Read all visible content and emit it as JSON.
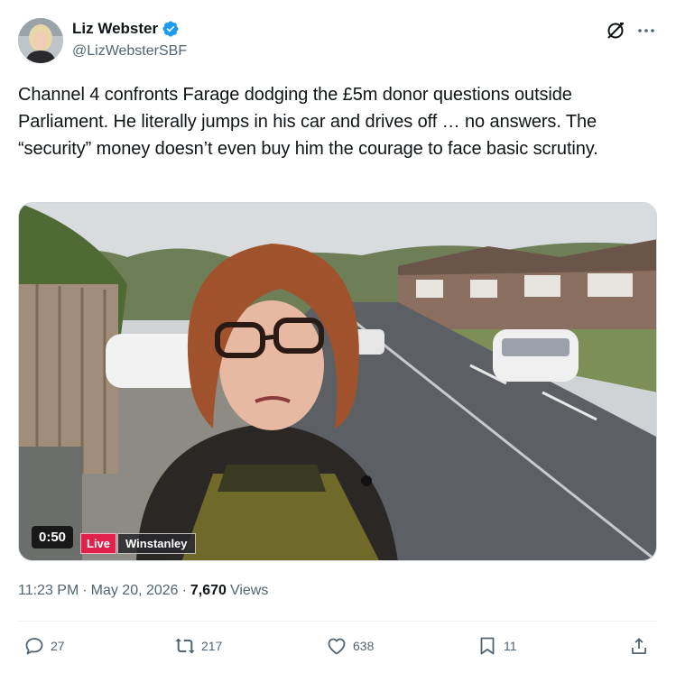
{
  "author": {
    "display_name": "Liz Webster",
    "handle": "@LizWebsterSBF",
    "verified": true
  },
  "tweet": {
    "text": "Channel 4 confronts Farage dodging the £5m donor questions outside Parliament. He literally jumps in his car and drives off … no answers. The “security” money doesn’t even buy him the courage to face basic scrutiny."
  },
  "media": {
    "duration": "0:50",
    "live_label": "Live",
    "location_label": "Winstanley"
  },
  "meta": {
    "time": "11:23 PM",
    "separator": "·",
    "date": "May 20, 2026",
    "views_count": "7,670",
    "views_label": "Views"
  },
  "actions": {
    "replies": "27",
    "reposts": "217",
    "likes": "638",
    "bookmarks": "11"
  },
  "colors": {
    "verified_blue": "#1d9bf0",
    "secondary_text": "#536471",
    "live_red": "#e0214a"
  }
}
